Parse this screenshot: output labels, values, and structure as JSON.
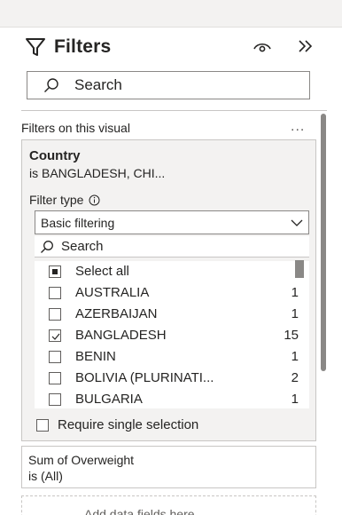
{
  "pane": {
    "title": "Filters",
    "search_placeholder": "Search",
    "section_label": "Filters on this visual",
    "section_more": "..."
  },
  "country_filter": {
    "title": "Country",
    "summary": "is BANGLADESH, CHI...",
    "filter_type_label": "Filter type",
    "filter_type_value": "Basic filtering",
    "search_placeholder": "Search",
    "select_all_label": "Select all",
    "items": [
      {
        "name": "AUSTRALIA",
        "count": "1",
        "checked": false
      },
      {
        "name": "AZERBAIJAN",
        "count": "1",
        "checked": false
      },
      {
        "name": "BANGLADESH",
        "count": "15",
        "checked": true
      },
      {
        "name": "BENIN",
        "count": "1",
        "checked": false
      },
      {
        "name": "BOLIVIA (PLURINATI...",
        "count": "2",
        "checked": false
      },
      {
        "name": "BULGARIA",
        "count": "1",
        "checked": false
      }
    ],
    "require_single_label": "Require single selection"
  },
  "overweight_filter": {
    "title": "Sum of Overweight",
    "summary": "is (All)"
  },
  "add_fields": {
    "label": "Add data fields here"
  },
  "colors": {
    "accent_text": "#252423",
    "card_bg": "#f3f2f1",
    "border": "#c8c6c4"
  }
}
